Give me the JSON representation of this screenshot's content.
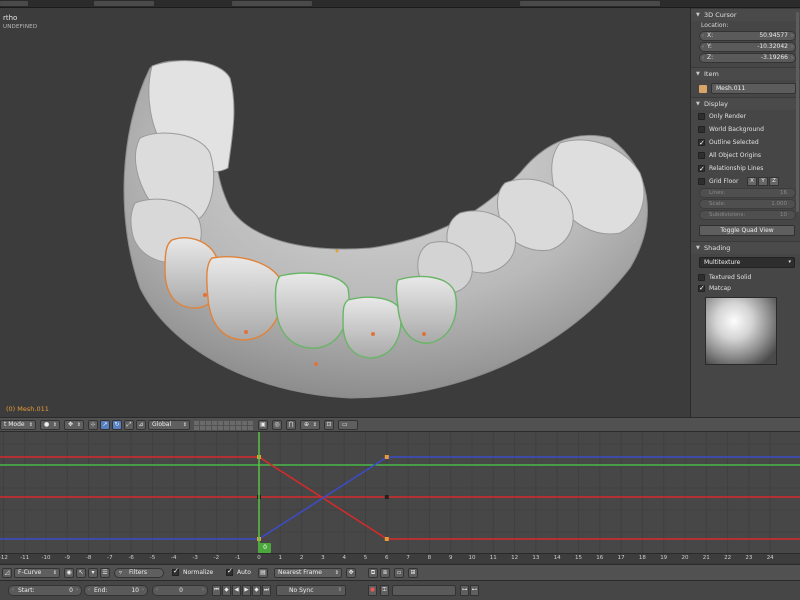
{
  "viewport": {
    "mode_label": "rtho",
    "sub_label": "UNDEFINED",
    "object_label": "(0) Mesh.011"
  },
  "panel": {
    "cursor": {
      "title": "3D Cursor",
      "location_label": "Location:",
      "fields": [
        {
          "axis": "X:",
          "value": "50.94577"
        },
        {
          "axis": "Y:",
          "value": "-10.32042"
        },
        {
          "axis": "Z:",
          "value": "-3.19266"
        }
      ]
    },
    "item": {
      "title": "Item",
      "name": "Mesh.011"
    },
    "display": {
      "title": "Display",
      "options": [
        {
          "label": "Only Render",
          "checked": false
        },
        {
          "label": "World Background",
          "checked": false
        },
        {
          "label": "Outline Selected",
          "checked": true
        },
        {
          "label": "All Object Origins",
          "checked": false
        },
        {
          "label": "Relationship Lines",
          "checked": true
        }
      ],
      "grid_floor": {
        "label": "Grid Floor",
        "axes": [
          "X",
          "Y",
          "Z"
        ]
      },
      "grid_fields": [
        {
          "label": "Lines:",
          "value": "16"
        },
        {
          "label": "Scale:",
          "value": "1.000"
        },
        {
          "label": "Subdivisions:",
          "value": "10"
        }
      ],
      "quad_button": "Toggle Quad View"
    },
    "shading": {
      "title": "Shading",
      "mode": "Multitexture",
      "textured_solid": "Textured Solid",
      "matcap": "Matcap"
    }
  },
  "view_header": {
    "mode": "t Mode",
    "orientation": "Global"
  },
  "graph": {
    "current_frame": "0",
    "frames": [
      "-12",
      "-11",
      "-10",
      "-9",
      "-8",
      "-7",
      "-6",
      "-5",
      "-4",
      "-3",
      "-2",
      "-1",
      "0",
      "1",
      "2",
      "3",
      "4",
      "5",
      "6",
      "7",
      "8",
      "9",
      "10",
      "11",
      "12",
      "13",
      "14",
      "15",
      "16",
      "17",
      "18",
      "19",
      "20",
      "21",
      "22",
      "23",
      "24"
    ],
    "colors": {
      "red": "#d82a2a",
      "green": "#49b94a",
      "blue": "#3b4cc9",
      "playhead": "#58c540"
    }
  },
  "graph_header": {
    "editor": "F-Curve",
    "filters": "Filters",
    "normalize": "Normalize",
    "auto": "Auto",
    "snap": "Nearest Frame"
  },
  "timeline": {
    "start_label": "Start:",
    "start": "0",
    "end_label": "End:",
    "end": "10",
    "current": "0",
    "sync": "No Sync"
  }
}
